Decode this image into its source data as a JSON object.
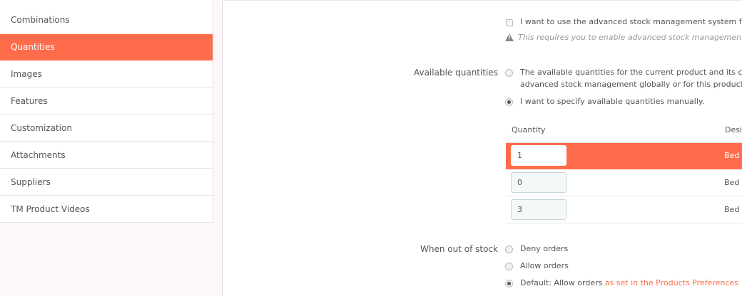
{
  "sidebar": {
    "items": [
      {
        "label": "Combinations",
        "active": false
      },
      {
        "label": "Quantities",
        "active": true
      },
      {
        "label": "Images",
        "active": false
      },
      {
        "label": "Features",
        "active": false
      },
      {
        "label": "Customization",
        "active": false
      },
      {
        "label": "Attachments",
        "active": false
      },
      {
        "label": "Suppliers",
        "active": false
      },
      {
        "label": "TM Product Videos",
        "active": false
      }
    ]
  },
  "stock": {
    "advanced_checkbox_label": "I want to use the advanced stock management system fo",
    "advanced_checked": false,
    "warning_text": "This requires you to enable advanced stock managemen"
  },
  "available": {
    "label": "Available quantities",
    "option1_line1": "The available quantities for the current product and its c",
    "option1_line2": "advanced stock management globally or for this product",
    "option2": "I want to specify available quantities manually.",
    "selected": "manual"
  },
  "table": {
    "headers": [
      "Quantity",
      "Desi"
    ],
    "rows": [
      {
        "quantity": "1",
        "desc": "Bed",
        "active": true
      },
      {
        "quantity": "0",
        "desc": "Bed",
        "active": false
      },
      {
        "quantity": "3",
        "desc": "Bed",
        "active": false
      }
    ]
  },
  "out_of_stock": {
    "label": "When out of stock",
    "options": [
      "Deny orders",
      "Allow orders",
      "Default: Allow orders"
    ],
    "default_link": "as set in the Products Preferences",
    "selected": "Default: Allow orders"
  },
  "colors": {
    "accent": "#ff6c4b"
  },
  "icons": {
    "warning": "warning-icon"
  }
}
